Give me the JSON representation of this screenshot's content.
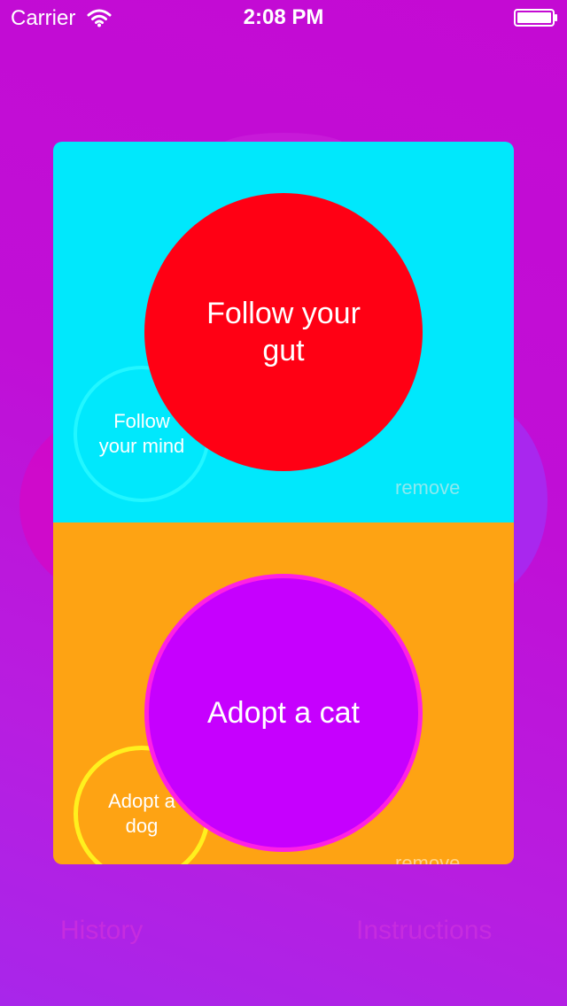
{
  "status_bar": {
    "carrier": "Carrier",
    "time": "2:08 PM"
  },
  "top_option": {
    "main": "Follow your gut",
    "alternative": "Follow your mind",
    "remove_label": "remove",
    "panel_color": "#00e8fc",
    "circle_color": "#ff0014"
  },
  "bottom_option": {
    "main": "Adopt a cat",
    "alternative": "Adopt a dog",
    "remove_label": "remove",
    "panel_color": "#fea313",
    "circle_color": "#c600fe"
  },
  "nav": {
    "history": "History",
    "instructions": "Instructions"
  }
}
